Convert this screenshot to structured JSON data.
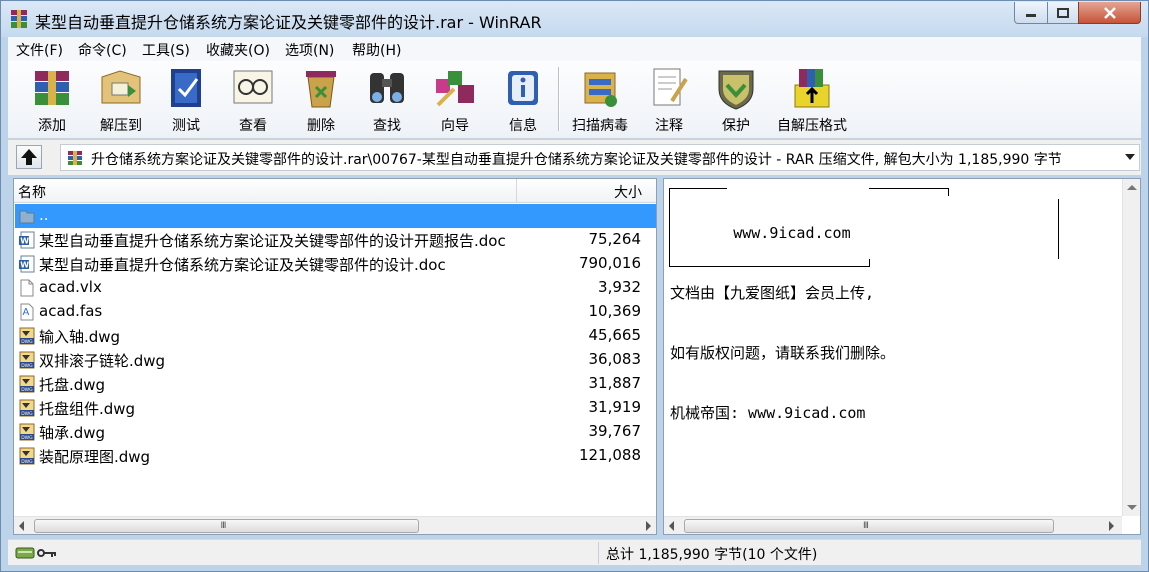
{
  "window": {
    "title": "某型自动垂直提升仓储系统方案论证及关键零部件的设计.rar - WinRAR"
  },
  "menu": [
    "文件(F)",
    "命令(C)",
    "工具(S)",
    "收藏夹(O)",
    "选项(N)",
    "帮助(H)"
  ],
  "toolbar": {
    "buttons": [
      {
        "label": "添加",
        "icon": "add-archive-icon"
      },
      {
        "label": "解压到",
        "icon": "extract-to-icon"
      },
      {
        "label": "测试",
        "icon": "test-icon"
      },
      {
        "label": "查看",
        "icon": "view-icon"
      },
      {
        "label": "删除",
        "icon": "delete-icon"
      },
      {
        "label": "查找",
        "icon": "find-icon"
      },
      {
        "label": "向导",
        "icon": "wizard-icon"
      },
      {
        "label": "信息",
        "icon": "info-icon"
      },
      {
        "label": "扫描病毒",
        "icon": "virus-scan-icon"
      },
      {
        "label": "注释",
        "icon": "comment-icon"
      },
      {
        "label": "保护",
        "icon": "protect-icon"
      },
      {
        "label": "自解压格式",
        "icon": "sfx-icon"
      }
    ]
  },
  "address": {
    "path": "升仓储系统方案论证及关键零部件的设计.rar\\00767-某型自动垂直提升仓储系统方案论证及关键零部件的设计 - RAR 压缩文件, 解包大小为 1,185,990 字节"
  },
  "filelist": {
    "col_name": "名称",
    "col_size": "大小",
    "rows": [
      {
        "name": "..",
        "size": "",
        "type": "folder"
      },
      {
        "name": "某型自动垂直提升仓储系统方案论证及关键零部件的设计开题报告.doc",
        "size": "75,264",
        "type": "doc"
      },
      {
        "name": "某型自动垂直提升仓储系统方案论证及关键零部件的设计.doc",
        "size": "790,016",
        "type": "doc"
      },
      {
        "name": "acad.vlx",
        "size": "3,932",
        "type": "blank"
      },
      {
        "name": "acad.fas",
        "size": "10,369",
        "type": "fas"
      },
      {
        "name": "输入轴.dwg",
        "size": "45,665",
        "type": "dwg"
      },
      {
        "name": "双排滚子链轮.dwg",
        "size": "36,083",
        "type": "dwg"
      },
      {
        "name": "托盘.dwg",
        "size": "31,887",
        "type": "dwg"
      },
      {
        "name": "托盘组件.dwg",
        "size": "31,919",
        "type": "dwg"
      },
      {
        "name": "轴承.dwg",
        "size": "39,767",
        "type": "dwg"
      },
      {
        "name": "装配原理图.dwg",
        "size": "121,088",
        "type": "dwg"
      }
    ]
  },
  "comment": {
    "lines": [
      "       www.9icad.com",
      "文档由【九爱图纸】会员上传,",
      "如有版权问题，请联系我们删除。",
      "机械帝国: www.9icad.com"
    ]
  },
  "status": {
    "total": "总计 1,185,990 字节(10 个文件)"
  }
}
